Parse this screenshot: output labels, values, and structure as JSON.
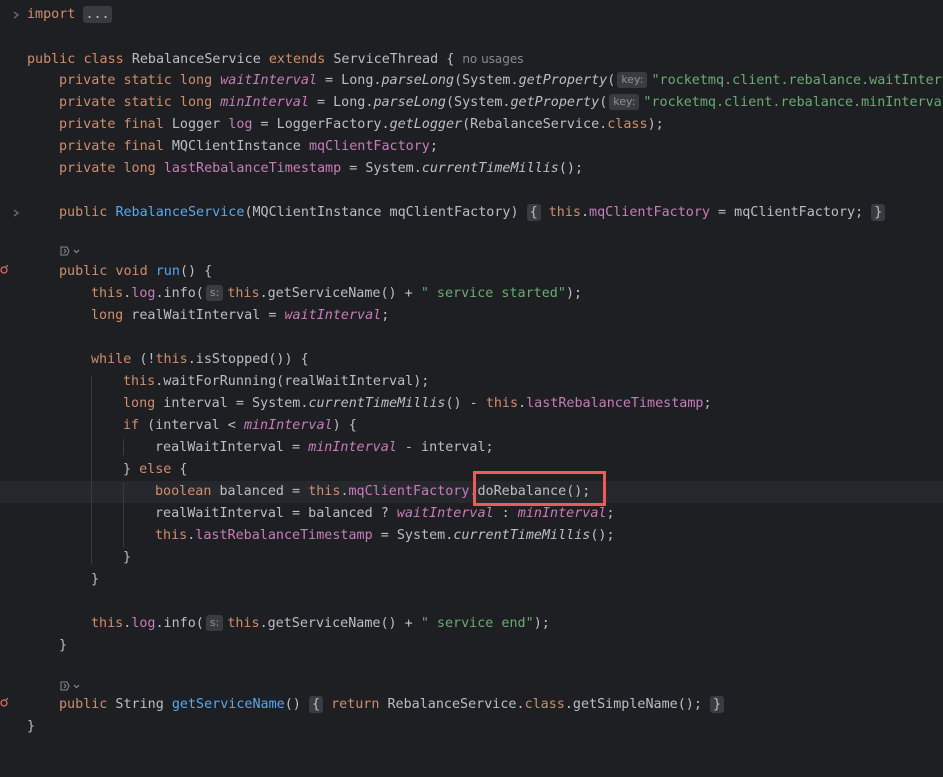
{
  "editor": {
    "highlight_color": "#ee5a5a",
    "background": "#1e1f22",
    "lines": {
      "l1_import": "import",
      "l1_dots": "...",
      "l3_public": "public",
      "l3_class": "class",
      "l3_name": "RebalanceService",
      "l3_extends": "extends",
      "l3_super": "ServiceThread",
      "l3_brace": "{",
      "l3_usages": "no usages",
      "l4_mods": "private static long",
      "l4_field": "waitInterval",
      "l4_eq": " = Long.",
      "l4_parse": "parseLong",
      "l4_sys": "(System.",
      "l4_getprop": "getProperty",
      "l4_paren": "(",
      "l4_hint": "key:",
      "l4_str": "\"rocketmq.client.rebalance.waitInterval\"",
      "l5_mods": "private static long",
      "l5_field": "minInterval",
      "l5_eq": " = Long.",
      "l5_parse": "parseLong",
      "l5_sys": "(System.",
      "l5_getprop": "getProperty",
      "l5_paren": "(",
      "l5_hint": "key:",
      "l5_str": "\"rocketmq.client.rebalance.minInterval\"",
      "l6_mods": "private final",
      "l6_type": " Logger ",
      "l6_field": "log",
      "l6_eq": " = LoggerFactory.",
      "l6_getlogger": "getLogger",
      "l6_arg": "(RebalanceService.",
      "l6_class": "class",
      "l6_end": ");",
      "l7_mods": "private final",
      "l7_type": " MQClientInstance ",
      "l7_field": "mqClientFactory",
      "l7_end": ";",
      "l8_mods": "private long",
      "l8_field": "lastRebalanceTimestamp",
      "l8_eq": " = System.",
      "l8_ctm": "currentTimeMillis",
      "l8_end": "();",
      "l10_public": "public",
      "l10_ctor": "RebalanceService",
      "l10_params": "(MQClientInstance mqClientFactory",
      "l10_paren": ")",
      "l10_lbrace": "{",
      "l10_this": "this",
      "l10_dot": ".",
      "l10_field": "mqClientFactory",
      "l10_assign": " = mqClientFactory;",
      "l10_rbrace": "}",
      "l12_public": "public void",
      "l12_run": "run",
      "l12_rest": "() {",
      "l13_this": "this",
      "l13_dot": ".",
      "l13_log": "log",
      "l13_info": ".info(",
      "l13_hint": "s:",
      "l13_this2": "this",
      "l13_call": ".getServiceName() + ",
      "l13_str": "\" service started\"",
      "l13_end": ");",
      "l14_long": "long",
      "l14_var": " realWaitInterval = ",
      "l14_field": "waitInterval",
      "l14_end": ";",
      "l16_while": "while",
      "l16_open": " (!",
      "l16_this": "this",
      "l16_rest": ".isStopped()) {",
      "l17_this": "this",
      "l17_rest": ".waitForRunning(realWaitInterval);",
      "l18_long": "long",
      "l18_var": " interval = System.",
      "l18_ctm": "currentTimeMillis",
      "l18_mid": "() - ",
      "l18_this": "this",
      "l18_dot": ".",
      "l18_field": "lastRebalanceTimestamp",
      "l18_end": ";",
      "l19_if": "if",
      "l19_open": " (interval < ",
      "l19_field": "minInterval",
      "l19_end": ") {",
      "l20_var": "realWaitInterval = ",
      "l20_field": "minInterval",
      "l20_end": " - interval;",
      "l21_close": "} ",
      "l21_else": "else",
      "l21_brace": " {",
      "l22_bool": "boolean",
      "l22_var": " balanced = ",
      "l22_this": "this",
      "l22_dot": ".",
      "l22_field": "mqClientFactory",
      "l22_dot2": ".",
      "l22_method": "doRebalance",
      "l22_end": "();",
      "l23_var": "realWaitInterval = balanced ? ",
      "l23_field1": "waitInterval",
      "l23_colon": " : ",
      "l23_field2": "minInterval",
      "l23_end": ";",
      "l24_this": "this",
      "l24_dot": ".",
      "l24_field": "lastRebalanceTimestamp",
      "l24_eq": " = System.",
      "l24_ctm": "currentTimeMillis",
      "l24_end": "();",
      "l25_close": "}",
      "l26_close": "}",
      "l28_this": "this",
      "l28_dot": ".",
      "l28_log": "log",
      "l28_info": ".info(",
      "l28_hint": "s:",
      "l28_this2": "this",
      "l28_call": ".getServiceName() + ",
      "l28_str": "\" service end\"",
      "l28_end": ");",
      "l29_close": "}",
      "l31_public": "public",
      "l31_type": " String ",
      "l31_method": "getServiceName",
      "l31_paren": "()",
      "l31_lbrace": "{",
      "l31_return": "return",
      "l31_body": " RebalanceService.",
      "l31_class": "class",
      "l31_rest": ".getSimpleName();",
      "l31_rbrace": "}",
      "l32_close": "}"
    }
  }
}
